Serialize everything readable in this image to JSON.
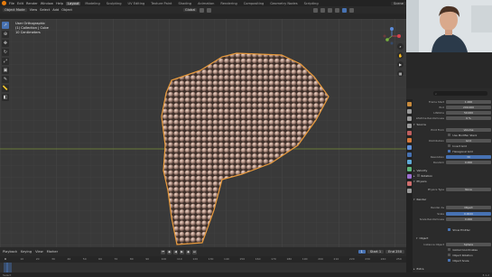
{
  "menubar": {
    "menus": [
      "File",
      "Edit",
      "Render",
      "Window",
      "Help"
    ],
    "tabs": [
      "Layout",
      "Modeling",
      "Sculpting",
      "UV Editing",
      "Texture Paint",
      "Shading",
      "Animation",
      "Rendering",
      "Compositing",
      "Geometry Nodes",
      "Scripting"
    ],
    "active_tab": "Layout",
    "scene": "Scene"
  },
  "viewport_header": {
    "mode": "Object Mode",
    "menus": [
      "View",
      "Select",
      "Add",
      "Object"
    ],
    "orientation": "Global"
  },
  "overlay": {
    "line1": "User Orthographic",
    "line2": "(1) Collection | Cube",
    "line3": "10 Centimeters"
  },
  "timeline": {
    "menus": [
      "Playback",
      "Keying",
      "View",
      "Marker"
    ],
    "current_frame": "1",
    "start_label": "Start",
    "start": "1",
    "end_label": "End",
    "end": "250",
    "ruler": [
      "0",
      "10",
      "20",
      "30",
      "40",
      "50",
      "60",
      "70",
      "80",
      "90",
      "100",
      "110",
      "120",
      "130",
      "140",
      "150",
      "160",
      "170",
      "180",
      "190",
      "200",
      "210",
      "220",
      "230",
      "240",
      "250"
    ]
  },
  "statusbar": {
    "left": "Select",
    "version": "3.1.2"
  },
  "properties": {
    "search_placeholder": "",
    "rows_top": [
      {
        "label": "Frame Start",
        "value": "1.000"
      },
      {
        "label": "End",
        "value": "200.000"
      },
      {
        "label": "Lifetime",
        "value": "50.000"
      },
      {
        "label": "Lifetime Randomness",
        "value": "0 %"
      }
    ],
    "source_header": "Source",
    "emit_from_label": "Emit From",
    "emit_from": "Volume",
    "use_modifier_stack": "Use Modifier Stack",
    "distribution_label": "Distribution",
    "distribution": "Grid",
    "invert_grid": "Invert Grid",
    "hexagonal_grid": "Hexagonal Grid",
    "resolution_label": "Resolution",
    "resolution": "30",
    "random_label": "Random",
    "random": "0.000",
    "velocity_header": "Velocity",
    "rotation_header": "Rotation",
    "physics_header": "Physics",
    "physics_type_label": "Physics Type",
    "physics_type": "None",
    "render_header": "Render",
    "render_as_label": "Render As",
    "render_as": "Object",
    "scale_label": "Scale",
    "scale": "0.0020",
    "scale_random_label": "Scale Randomness",
    "scale_random": "0.000",
    "show_emitter": "Show Emitter",
    "object_header": "Object",
    "instance_object_label": "Instance Object",
    "instance_object": "Sphere",
    "global_coordinates": "Global Coordinates",
    "object_rotation": "Object Rotation",
    "object_scale": "Object Scale",
    "extra_header": "Extra"
  },
  "colors": {
    "accent": "#4772b3",
    "brand": "#e87d0d",
    "selection_outline": "#e89a3c",
    "particle": "#b08f7e"
  }
}
